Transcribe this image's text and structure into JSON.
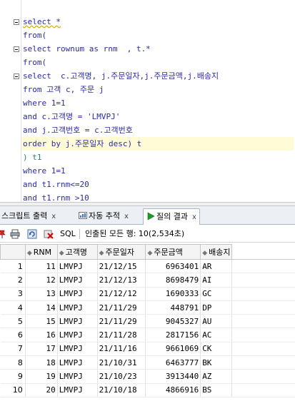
{
  "editor": {
    "lines": [
      {
        "t": "select *"
      },
      {
        "t": "from("
      },
      {
        "t": "select rownum as rnm  , t.*"
      },
      {
        "t": "from("
      },
      {
        "t": "select  c.고객명, j.주문일자,j.주문금액,j.배송지"
      },
      {
        "t": "from 고객 c, 주문 j"
      },
      {
        "t": "where 1=1"
      },
      {
        "t": "and c.고객명 = 'LMVPJ'"
      },
      {
        "t": "and j.고객번호 = c.고객번호"
      },
      {
        "t": "order by j.주문일자 desc) t"
      },
      {
        "t": ") t1"
      },
      {
        "t": "where 1=1"
      },
      {
        "t": "and t1.rnm<=20"
      },
      {
        "t": "and t1.rnm >10"
      }
    ]
  },
  "tabs": [
    {
      "label": "스크립트 출력",
      "close": "x"
    },
    {
      "label": "자동 추적",
      "close": "x"
    },
    {
      "label": "질의 결과",
      "close": "x"
    }
  ],
  "toolbar": {
    "sql_label": "SQL",
    "status": "인출된 모든 행: 10(2,534초)"
  },
  "grid": {
    "columns": [
      "RNM",
      "고객명",
      "주문일자",
      "주문금액",
      "배송지"
    ],
    "rows": [
      {
        "n": "1",
        "rnm": "11",
        "name": "LMVPJ",
        "date": "21/12/15",
        "amount": "6963401",
        "dest": "AR"
      },
      {
        "n": "2",
        "rnm": "12",
        "name": "LMVPJ",
        "date": "21/12/13",
        "amount": "8698479",
        "dest": "AI"
      },
      {
        "n": "3",
        "rnm": "13",
        "name": "LMVPJ",
        "date": "21/12/12",
        "amount": "1690333",
        "dest": "GC"
      },
      {
        "n": "4",
        "rnm": "14",
        "name": "LMVPJ",
        "date": "21/11/29",
        "amount": "448791",
        "dest": "DP"
      },
      {
        "n": "5",
        "rnm": "15",
        "name": "LMVPJ",
        "date": "21/11/29",
        "amount": "9045327",
        "dest": "AU"
      },
      {
        "n": "6",
        "rnm": "16",
        "name": "LMVPJ",
        "date": "21/11/28",
        "amount": "2817156",
        "dest": "AC"
      },
      {
        "n": "7",
        "rnm": "17",
        "name": "LMVPJ",
        "date": "21/11/16",
        "amount": "9661069",
        "dest": "CK"
      },
      {
        "n": "8",
        "rnm": "18",
        "name": "LMVPJ",
        "date": "21/10/31",
        "amount": "6463777",
        "dest": "BK"
      },
      {
        "n": "9",
        "rnm": "19",
        "name": "LMVPJ",
        "date": "21/10/23",
        "amount": "3913440",
        "dest": "AZ"
      },
      {
        "n": "10",
        "rnm": "20",
        "name": "LMVPJ",
        "date": "21/10/18",
        "amount": "4866916",
        "dest": "BS"
      }
    ]
  },
  "colors": {
    "keyword": "#2a2aa6",
    "string": "#a31515",
    "alias": "#2d7d7d",
    "current_line": "#fffbd6",
    "run_icon": "#1a9c2a"
  },
  "icons": [
    "fold-minus-icon",
    "script-output-icon",
    "autotrace-icon",
    "run-query-icon",
    "pin-icon",
    "print-icon",
    "refresh-icon",
    "cancel-icon",
    "sort-icon"
  ]
}
